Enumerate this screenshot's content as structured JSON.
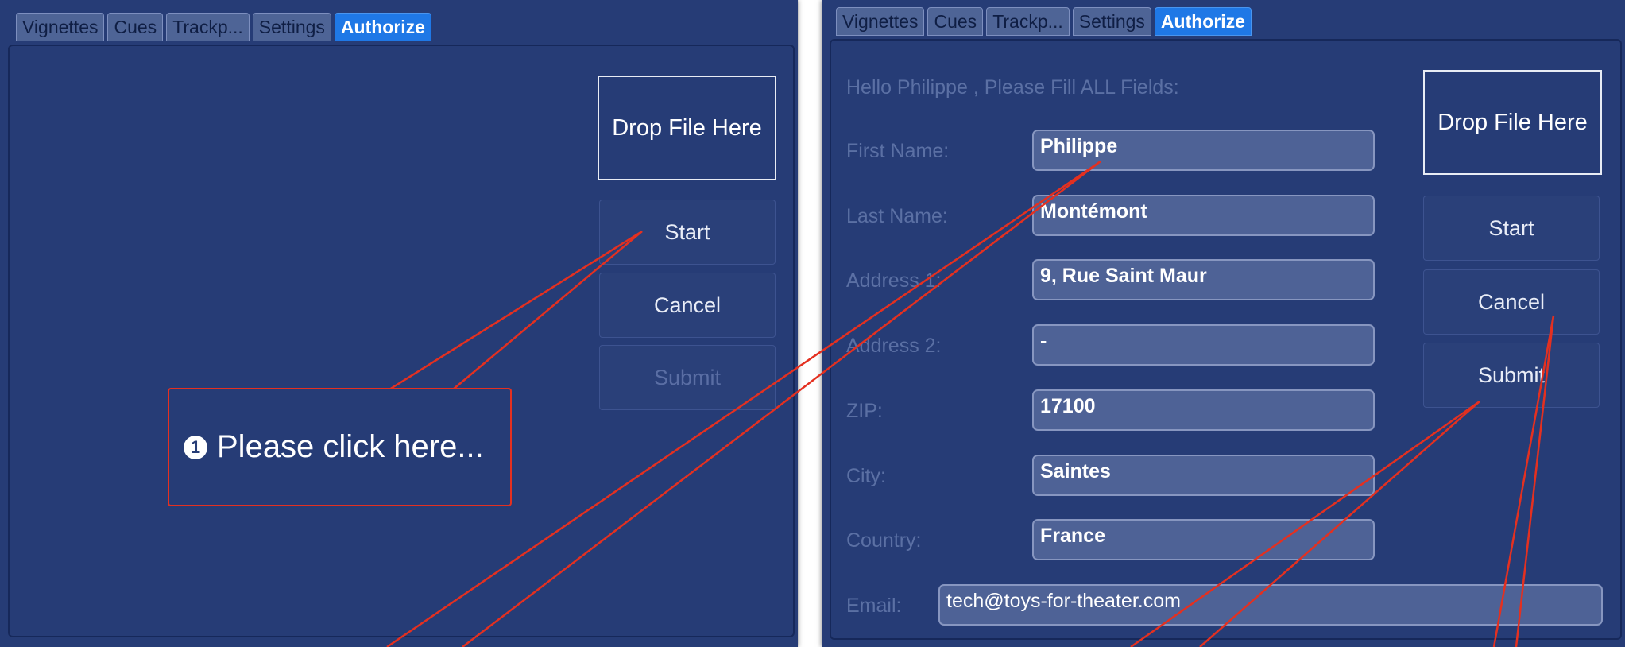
{
  "tabs": [
    {
      "label": "Vignettes"
    },
    {
      "label": "Cues"
    },
    {
      "label": "Trackp..."
    },
    {
      "label": "Settings"
    },
    {
      "label": "Authorize"
    }
  ],
  "drop_label": "Drop File Here",
  "buttons": {
    "start": "Start",
    "cancel": "Cancel",
    "submit": "Submit"
  },
  "form": {
    "heading": "Hello Philippe , Please Fill ALL Fields:",
    "fields": [
      {
        "label": "First Name:",
        "value": "Philippe"
      },
      {
        "label": "Last Name:",
        "value": "Montémont"
      },
      {
        "label": "Address 1:",
        "value": "9, Rue Saint Maur"
      },
      {
        "label": "Address 2:",
        "value": "-"
      },
      {
        "label": "ZIP:",
        "value": "17100"
      },
      {
        "label": "City:",
        "value": "Saintes"
      },
      {
        "label": "Country:",
        "value": "France"
      },
      {
        "label": "Email:",
        "value": "tech@toys-for-theater.com"
      }
    ]
  },
  "callout": {
    "number": "1",
    "text": "Please click here..."
  },
  "colors": {
    "panel": "#263c76",
    "active_tab": "#1f78e6",
    "annotation": "#e43020"
  }
}
